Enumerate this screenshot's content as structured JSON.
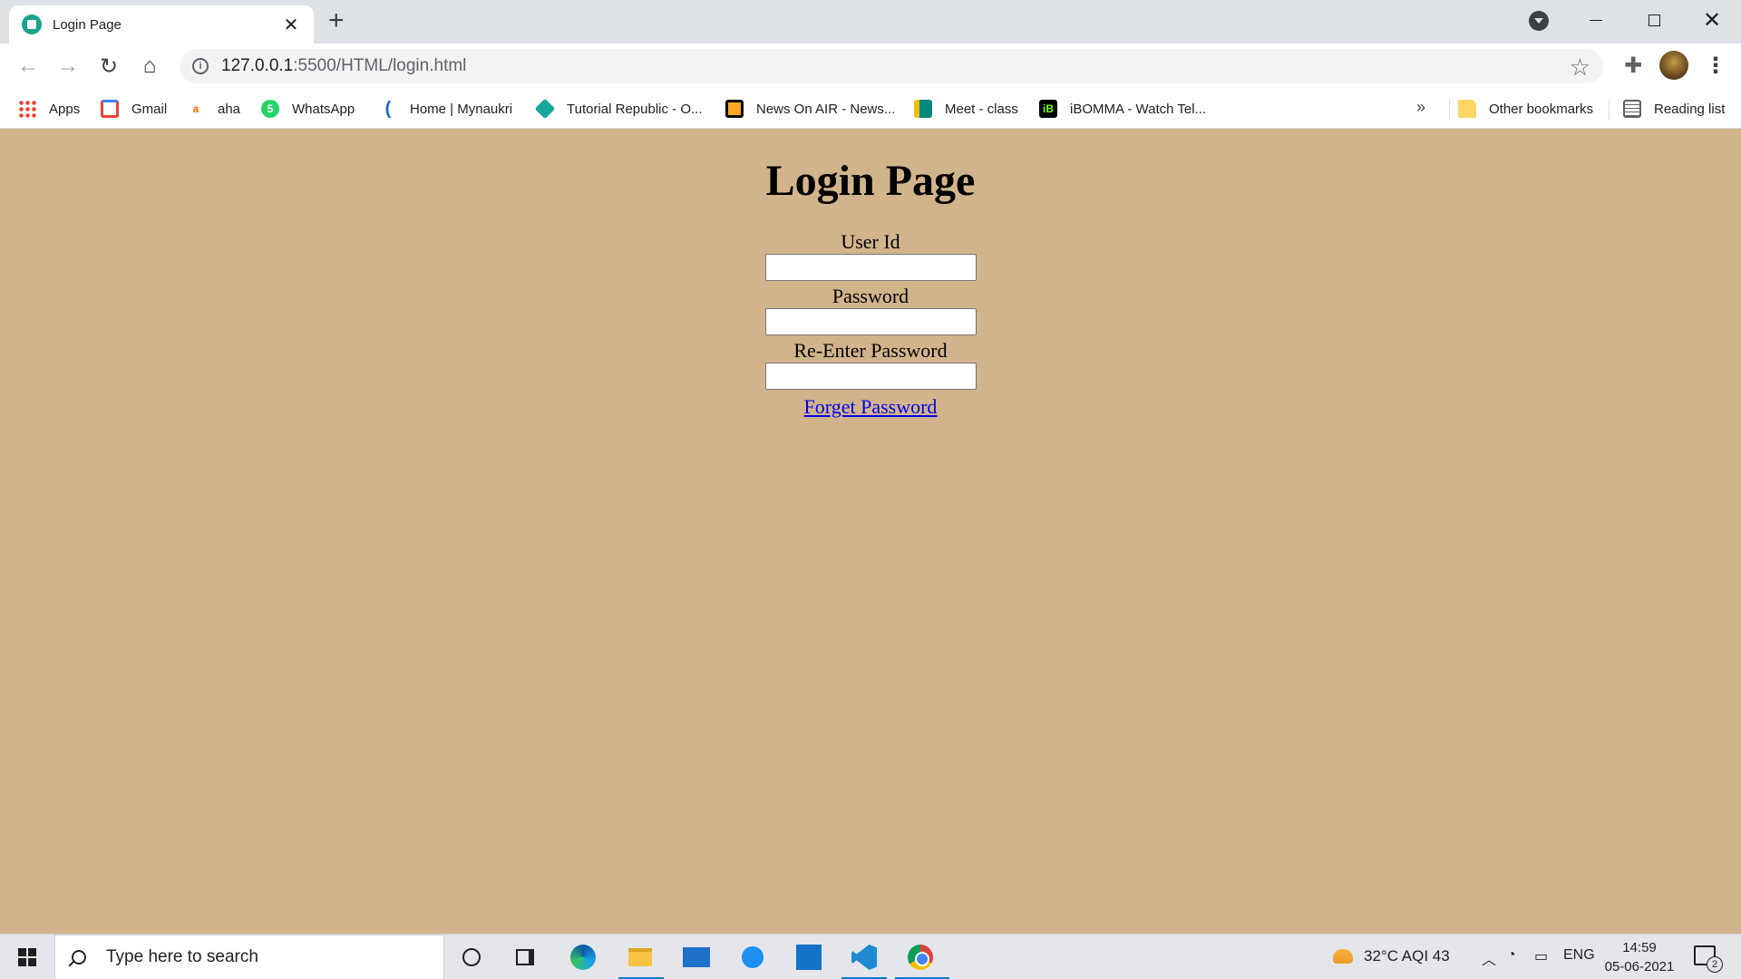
{
  "browser": {
    "tab_title": "Login Page",
    "tab_close": "✕",
    "new_tab": "+",
    "url_host": "127.0.0.1",
    "url_rest": ":5500/HTML/login.html"
  },
  "bookmarks": [
    {
      "label": "Apps",
      "icon": "apps-grid-icon"
    },
    {
      "label": "Gmail",
      "icon": "gmail-icon"
    },
    {
      "label": "aha",
      "icon": "aha-icon"
    },
    {
      "label": "WhatsApp",
      "icon": "whatsapp-icon"
    },
    {
      "label": "Home | Mynaukri",
      "icon": "mynaukri-icon"
    },
    {
      "label": "Tutorial Republic - O...",
      "icon": "tutorial-republic-icon"
    },
    {
      "label": "News On AIR - News...",
      "icon": "news-on-air-icon"
    },
    {
      "label": "Meet - class",
      "icon": "google-meet-icon"
    },
    {
      "label": "iBOMMA - Watch Tel...",
      "icon": "ibomma-icon"
    }
  ],
  "bookmarks_more": "»",
  "other_bookmarks": "Other bookmarks",
  "reading_list": "Reading list",
  "page": {
    "title": "Login Page",
    "fields": [
      {
        "label": "User Id",
        "value": ""
      },
      {
        "label": "Password",
        "value": ""
      },
      {
        "label": "Re-Enter Password",
        "value": ""
      }
    ],
    "forgot_link": "Forget Password",
    "background_color": "#d2b48c",
    "link_color": "#0000ee"
  },
  "taskbar": {
    "search_placeholder": "Type here to search",
    "weather": "32°C  AQI 43",
    "language": "ENG",
    "time": "14:59",
    "date": "05-06-2021",
    "notification_count": "2"
  }
}
